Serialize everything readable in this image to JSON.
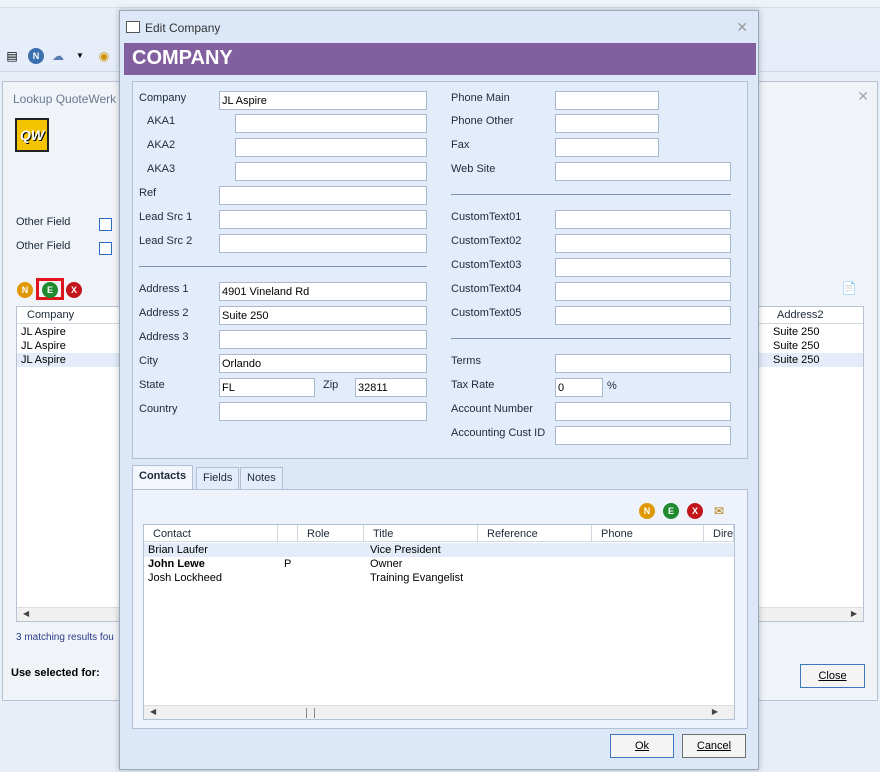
{
  "lookup": {
    "title": "Lookup QuoteWerk",
    "logo_text": "QW",
    "other_field_1": "Other Field",
    "other_field_2": "Other Field",
    "btn_n": "N",
    "btn_e": "E",
    "btn_x": "X",
    "col_company": "Company",
    "col_address2": "Address2",
    "rows": [
      {
        "company": "JL Aspire",
        "address2": "Suite 250"
      },
      {
        "company": "JL Aspire",
        "address2": "Suite 250"
      },
      {
        "company": "JL Aspire",
        "address2": "Suite 250"
      }
    ],
    "status": "3 matching results fou",
    "use_selected": "Use selected for:",
    "close_label": "Close"
  },
  "dialog": {
    "title": "Edit Company",
    "banner": "COMPANY",
    "fields": {
      "company_label": "Company",
      "company_value": "JL Aspire",
      "aka1_label": "AKA1",
      "aka1_value": "",
      "aka2_label": "AKA2",
      "aka2_value": "",
      "aka3_label": "AKA3",
      "aka3_value": "",
      "ref_label": "Ref",
      "ref_value": "",
      "lead1_label": "Lead Src 1",
      "lead1_value": "",
      "lead2_label": "Lead Src 2",
      "lead2_value": "",
      "addr1_label": "Address 1",
      "addr1_value": "4901 Vineland Rd",
      "addr2_label": "Address 2",
      "addr2_value": "Suite 250",
      "addr3_label": "Address 3",
      "addr3_value": "",
      "city_label": "City",
      "city_value": "Orlando",
      "state_label": "State",
      "state_value": "FL",
      "zip_label": "Zip",
      "zip_value": "32811",
      "country_label": "Country",
      "country_value": "",
      "phone_main_label": "Phone Main",
      "phone_main_value": "",
      "phone_other_label": "Phone Other",
      "phone_other_value": "",
      "fax_label": "Fax",
      "fax_value": "",
      "website_label": "Web Site",
      "website_value": "",
      "ct1_label": "CustomText01",
      "ct1_value": "",
      "ct2_label": "CustomText02",
      "ct2_value": "",
      "ct3_label": "CustomText03",
      "ct3_value": "",
      "ct4_label": "CustomText04",
      "ct4_value": "",
      "ct5_label": "CustomText05",
      "ct5_value": "",
      "terms_label": "Terms",
      "terms_value": "",
      "taxrate_label": "Tax Rate",
      "taxrate_value": "0",
      "taxrate_unit": "%",
      "acctnum_label": "Account Number",
      "acctnum_value": "",
      "acctcust_label": "Accounting Cust ID",
      "acctcust_value": ""
    },
    "tabs": [
      "Contacts",
      "Fields",
      "Notes"
    ],
    "contacts": {
      "btn_n": "N",
      "btn_e": "E",
      "btn_x": "X",
      "columns": [
        "Contact",
        "",
        "Role",
        "Title",
        "Reference",
        "Phone",
        "Dire"
      ],
      "rows": [
        {
          "contact": "Brian Laufer",
          "flag": "",
          "title": "Vice President"
        },
        {
          "contact": "John Lewe",
          "flag": "P",
          "title": "Owner"
        },
        {
          "contact": "Josh Lockheed",
          "flag": "",
          "title": "Training Evangelist"
        }
      ]
    },
    "ok_label": "Ok",
    "cancel_label": "Cancel"
  },
  "colors": {
    "banner": "#8260a0",
    "btn_n": "#e09800",
    "btn_e": "#1f8a2e",
    "btn_x": "#c3161c"
  },
  "icons": [
    "contact-card-icon",
    "n-badge-icon",
    "chat-icon",
    "dropdown-arrow-icon",
    "map-pin-check-icon",
    "export-icon",
    "email-icon"
  ]
}
